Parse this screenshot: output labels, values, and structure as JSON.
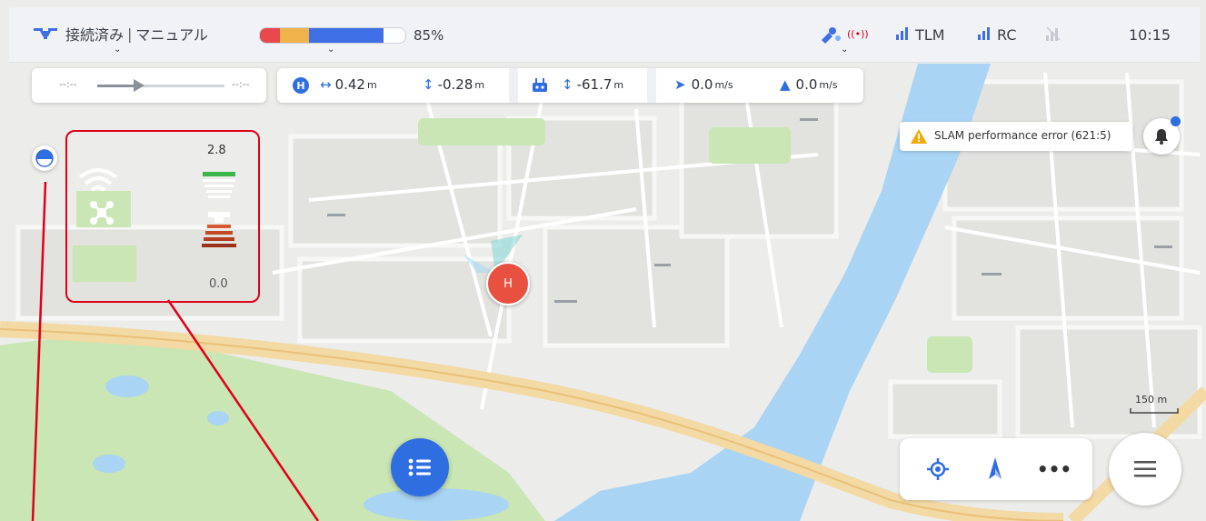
{
  "header": {
    "connection_status": "接続済み",
    "flight_mode": "マニュアル",
    "battery_percent": "85%",
    "battery_level": 85,
    "tlm_label": "TLM",
    "rc_label": "RC",
    "clock": "10:15"
  },
  "mission_progress": {
    "start_time": "--:--",
    "end_time": "--:--"
  },
  "telemetry": {
    "home_horizontal": "0.42",
    "home_horizontal_unit": "m",
    "home_vertical": "-0.28",
    "home_vertical_unit": "m",
    "rc_vertical": "-61.7",
    "rc_vertical_unit": "m",
    "horizontal_speed": "0.0",
    "horizontal_speed_unit": "m/s",
    "vertical_speed": "0.0",
    "vertical_speed_unit": "m/s"
  },
  "alert": {
    "text": "SLAM performance error (621:5)"
  },
  "sensor_panel": {
    "top_value": "2.8",
    "bottom_value": "0.0"
  },
  "map": {
    "home_label": "H",
    "scale_label": "150 m"
  },
  "colors": {
    "accent": "#2f6ee0",
    "home_marker": "#e8513f",
    "annotation": "#e0001a",
    "warning": "#f2a900",
    "battery_red": "#e8474b",
    "battery_orange": "#f0b24a",
    "battery_blue": "#3f6fe4"
  }
}
